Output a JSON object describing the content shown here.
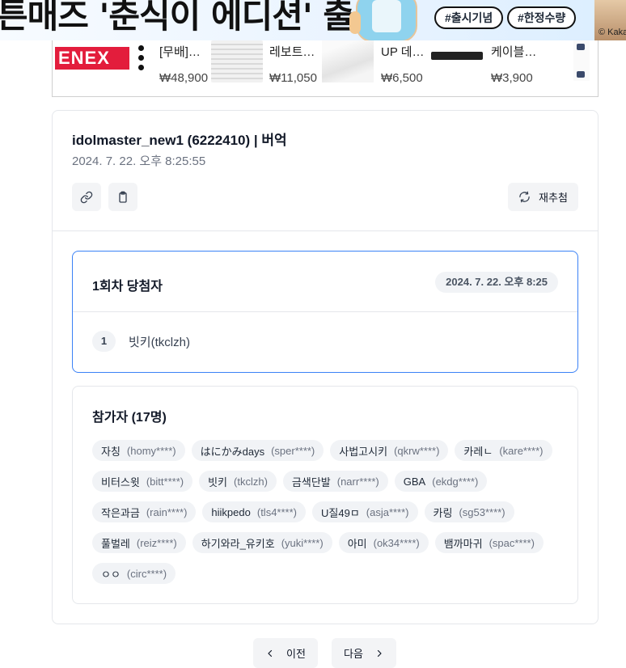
{
  "banner": {
    "headline": "튼매즈 '춘식이 에디션' 출시",
    "tags": [
      "#출시기념",
      "#한정수량"
    ],
    "copyright": "© Kakao"
  },
  "shop": {
    "brand_logo": "ENEX",
    "products": [
      {
        "name": "[무배]…",
        "price": "₩48,900"
      },
      {
        "name": "레보트…",
        "price": "₩11,050"
      },
      {
        "name": "UP 데…",
        "price": "₩6,500"
      },
      {
        "name": "케이블…",
        "price": "₩3,900"
      }
    ]
  },
  "result": {
    "title": "idolmaster_new1 (6222410) | 버억",
    "date": "2024. 7. 22. 오후 8:25:55",
    "icons": {
      "link": "link-icon",
      "copy": "clipboard-icon",
      "redraw": "refresh-icon"
    },
    "redraw_label": "재추첨"
  },
  "winners": {
    "title": "1회차 당첨자",
    "round_time": "2024. 7. 22. 오후 8:25",
    "list": [
      {
        "rank": "1",
        "name": "빗키(tkclzh)"
      }
    ]
  },
  "participants": {
    "title": "참가자 (17명)",
    "list": [
      {
        "name": "자칭",
        "id": "(homy****)"
      },
      {
        "name": "はにかみdays",
        "id": "(sper****)"
      },
      {
        "name": "사법고시키",
        "id": "(qkrw****)"
      },
      {
        "name": "카레ㄴ",
        "id": "(kare****)"
      },
      {
        "name": "비터스윗",
        "id": "(bitt****)"
      },
      {
        "name": "빗키",
        "id": "(tkclzh)"
      },
      {
        "name": "금색단발",
        "id": "(narr****)"
      },
      {
        "name": "GBA",
        "id": "(ekdg****)"
      },
      {
        "name": "작은과금",
        "id": "(rain****)"
      },
      {
        "name": "hiikpedo",
        "id": "(tls4****)"
      },
      {
        "name": "U질49ㅁ",
        "id": "(asja****)"
      },
      {
        "name": "카링",
        "id": "(sg53****)"
      },
      {
        "name": "풀벌레",
        "id": "(reiz****)"
      },
      {
        "name": "하기와라_유키호",
        "id": "(yuki****)"
      },
      {
        "name": "아미",
        "id": "(ok34****)"
      },
      {
        "name": "뱀까마귀",
        "id": "(spac****)"
      },
      {
        "name": "ㅇㅇ",
        "id": "(circ****)"
      }
    ]
  },
  "pagination": {
    "prev_label": "이전",
    "next_label": "다음"
  }
}
